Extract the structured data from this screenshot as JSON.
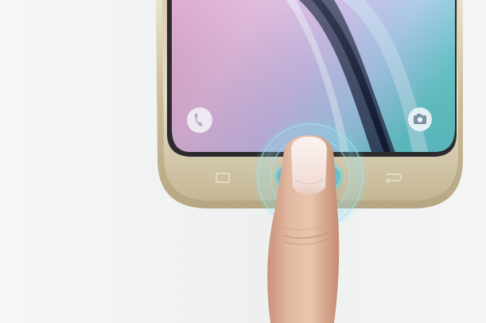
{
  "photo": {
    "subject": "smartphone-fingerprint-home-button-touch",
    "icons": {
      "left": "phone-icon",
      "right": "camera-icon",
      "home": "home-button-icon",
      "recent": "recent-apps-icon",
      "back": "back-icon"
    },
    "colors": {
      "background": "#f2f3f2",
      "phone_frame": "#cfc3a3",
      "phone_frame_dark": "#a99b78",
      "screen_pink": "#d9a6cf",
      "screen_lavender": "#b7a9dc",
      "screen_teal": "#7fc7cf",
      "fingerprint_glow": "#8fe0ea",
      "finger_skin": "#ddb49a",
      "nail": "#f6ece9"
    }
  }
}
